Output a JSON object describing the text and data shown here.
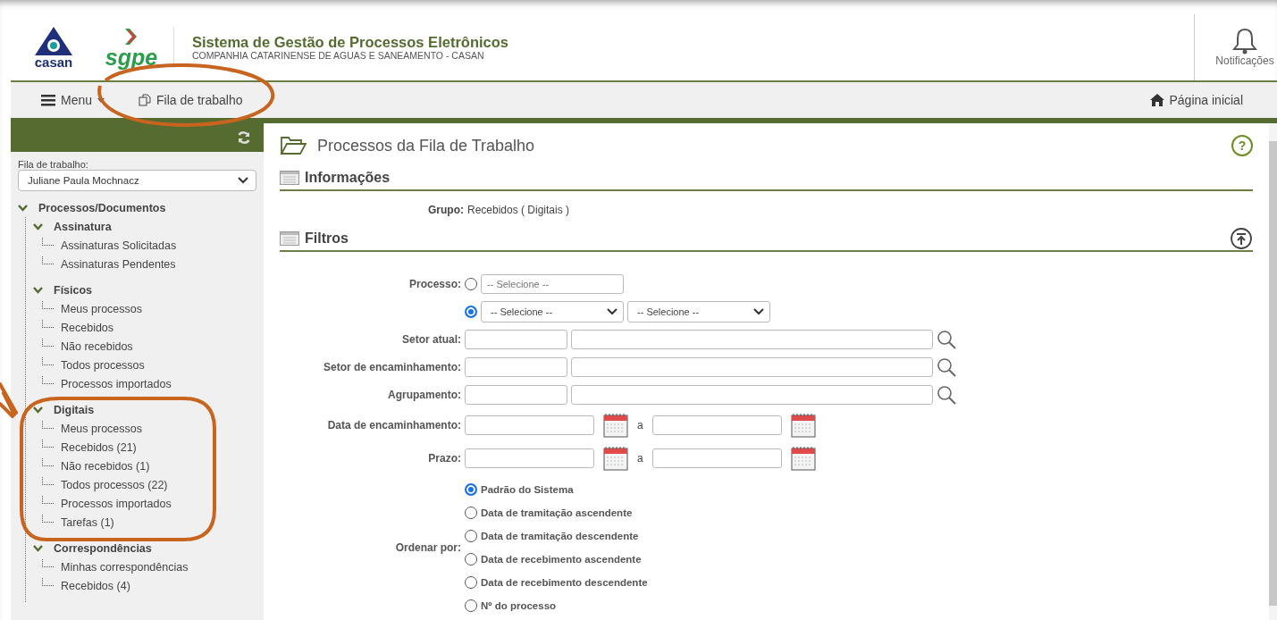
{
  "header": {
    "logo_left": "casan",
    "logo_right": "sgpe",
    "title": "Sistema de Gestão de Processos Eletrônicos",
    "subtitle": "COMPANHIA CATARINENSE DE AGUAS E SANEAMENTO - CASAN",
    "notifications": "Notificações"
  },
  "nav": {
    "menu": "Menu",
    "work_queue": "Fila de trabalho",
    "home": "Página inicial"
  },
  "sidebar": {
    "queue_label": "Fila de trabalho:",
    "queue_value": "Juliane Paula Mochnacz",
    "tree": [
      {
        "label": "Processos/Documentos",
        "expanded": true,
        "children": [
          {
            "label": "Assinatura",
            "expanded": true,
            "children": [
              {
                "label": "Assinaturas Solicitadas"
              },
              {
                "label": "Assinaturas Pendentes"
              }
            ]
          },
          {
            "label": "Físicos",
            "expanded": true,
            "children": [
              {
                "label": "Meus processos"
              },
              {
                "label": "Recebidos"
              },
              {
                "label": "Não recebidos"
              },
              {
                "label": "Todos processos"
              },
              {
                "label": "Processos importados"
              }
            ]
          },
          {
            "label": "Digitais",
            "expanded": true,
            "children": [
              {
                "label": "Meus processos"
              },
              {
                "label": "Recebidos (21)"
              },
              {
                "label": "Não recebidos (1)"
              },
              {
                "label": "Todos processos (22)"
              },
              {
                "label": "Processos importados"
              },
              {
                "label": "Tarefas (1)"
              }
            ]
          },
          {
            "label": "Correspondências",
            "expanded": true,
            "children": [
              {
                "label": "Minhas correspondências"
              },
              {
                "label": "Recebidos (4)"
              }
            ]
          }
        ]
      }
    ]
  },
  "page_title": "Processos da Fila de Trabalho",
  "help": "?",
  "info": {
    "heading": "Informações",
    "group_label": "Grupo:",
    "group_value": "Recebidos  ( Digitais )"
  },
  "filters": {
    "heading": "Filtros",
    "process_label": "Processo:",
    "process_options": [
      {
        "selected": false,
        "placeholder": "-- Selecione --",
        "kind": "input"
      },
      {
        "selected": true,
        "kind": "selects",
        "values": [
          "-- Selecione --",
          "-- Selecione --"
        ]
      }
    ],
    "lookups": [
      {
        "label": "Setor atual:"
      },
      {
        "label": "Setor de encaminhamento:"
      },
      {
        "label": "Agrupamento:"
      }
    ],
    "dates": [
      {
        "label": "Data de encaminhamento:",
        "sep": "a"
      },
      {
        "label": "Prazo:",
        "sep": "a"
      }
    ],
    "order_label": "Ordenar por:",
    "order_options": [
      {
        "label": "Padrão do Sistema",
        "selected": true
      },
      {
        "label": "Data de tramitação ascendente",
        "selected": false
      },
      {
        "label": "Data de tramitação descendente",
        "selected": false
      },
      {
        "label": "Data de recebimento ascendente",
        "selected": false
      },
      {
        "label": "Data de recebimento descendente",
        "selected": false
      },
      {
        "label": "Nº do processo",
        "selected": false
      }
    ]
  }
}
